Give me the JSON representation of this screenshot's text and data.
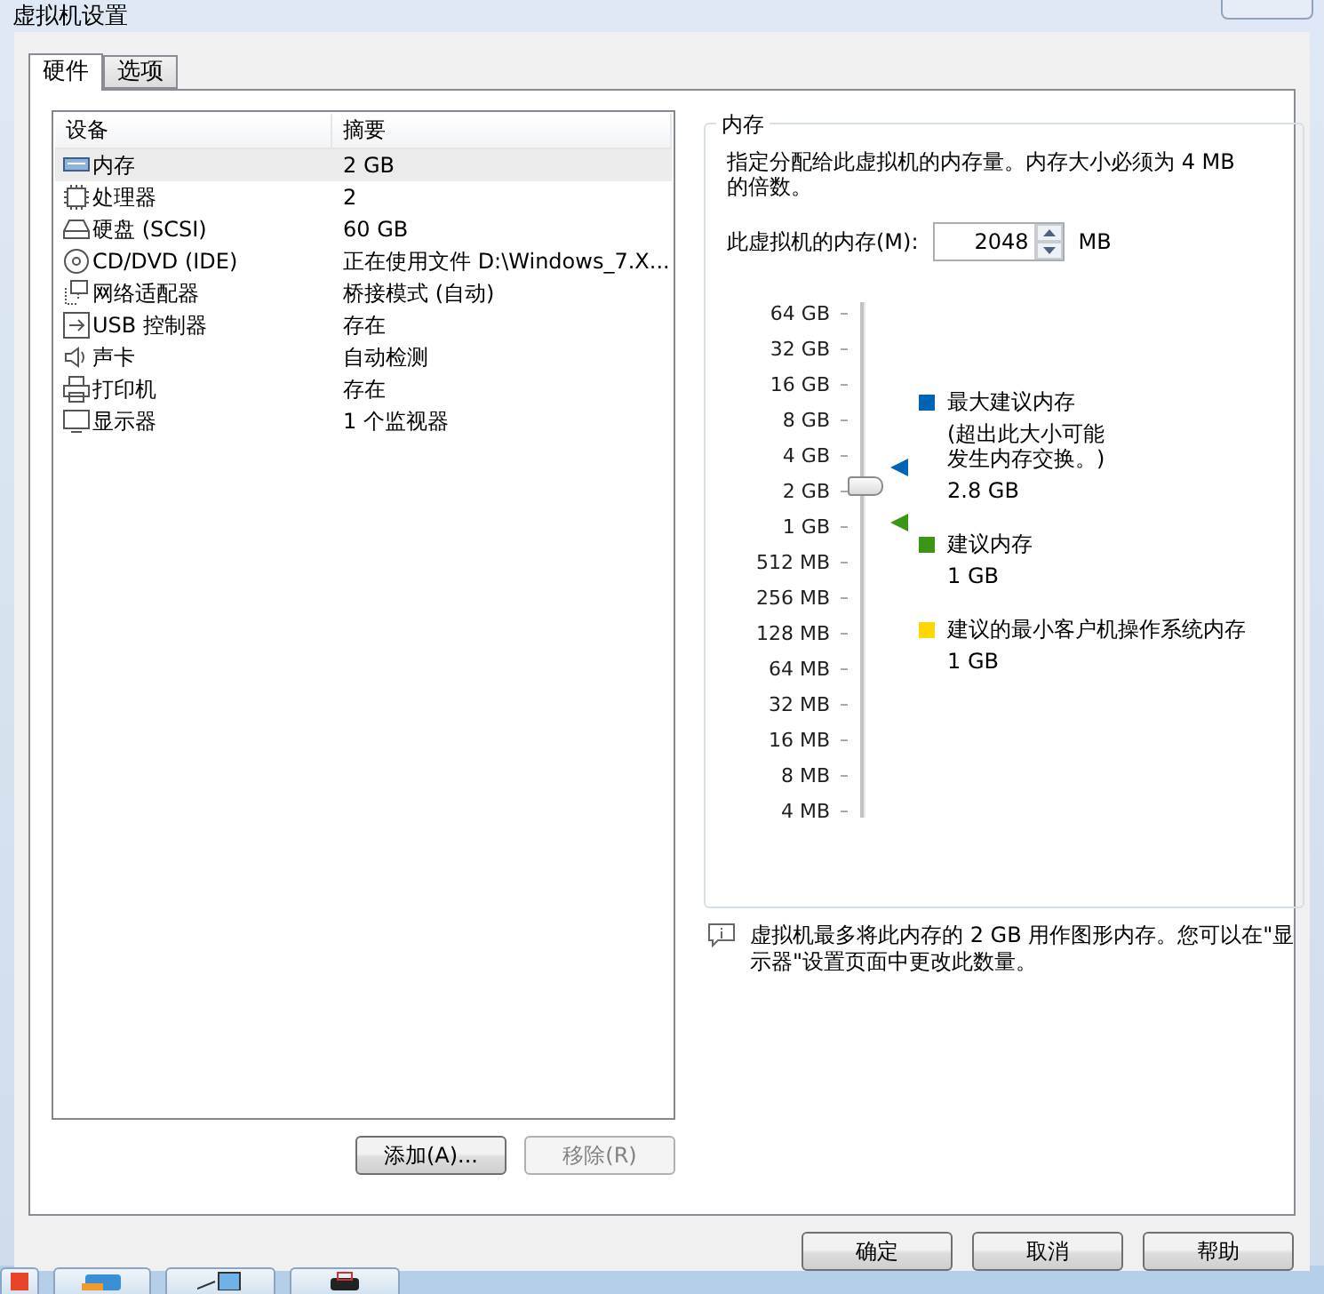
{
  "window": {
    "title": "虚拟机设置"
  },
  "tabs": [
    {
      "label": "硬件",
      "selected": true
    },
    {
      "label": "选项",
      "selected": false
    }
  ],
  "device_table": {
    "columns": [
      "设备",
      "摘要"
    ],
    "rows": [
      {
        "kind": "memory",
        "device": "内存",
        "summary": "2 GB",
        "selected": true
      },
      {
        "kind": "cpu",
        "device": "处理器",
        "summary": "2",
        "selected": false
      },
      {
        "kind": "disk",
        "device": "硬盘 (SCSI)",
        "summary": "60 GB",
        "selected": false
      },
      {
        "kind": "cd",
        "device": "CD/DVD (IDE)",
        "summary": "正在使用文件 D:\\Windows_7.X...",
        "selected": false
      },
      {
        "kind": "network",
        "device": "网络适配器",
        "summary": "桥接模式 (自动)",
        "selected": false
      },
      {
        "kind": "usb",
        "device": "USB 控制器",
        "summary": "存在",
        "selected": false
      },
      {
        "kind": "sound",
        "device": "声卡",
        "summary": "自动检测",
        "selected": false
      },
      {
        "kind": "printer",
        "device": "打印机",
        "summary": "存在",
        "selected": false
      },
      {
        "kind": "display",
        "device": "显示器",
        "summary": "1 个监视器",
        "selected": false
      }
    ]
  },
  "list_buttons": [
    {
      "label": "添加(A)...",
      "disabled": false
    },
    {
      "label": "移除(R)",
      "disabled": true
    }
  ],
  "memory_group": {
    "title": "内存",
    "description": "指定分配给此虚拟机的内存量。内存大小必须为 4 MB 的倍数。",
    "field_label": "此虚拟机的内存(M):",
    "value": "2048",
    "unit": "MB",
    "scale_labels": [
      "64 GB",
      "32 GB",
      "16 GB",
      "8 GB",
      "4 GB",
      "2 GB",
      "1 GB",
      "512 MB",
      "256 MB",
      "128 MB",
      "64 MB",
      "32 MB",
      "16 MB",
      "8 MB",
      "4 MB"
    ],
    "slider": {
      "level": 0.643
    },
    "legend": [
      {
        "title": "最大建议内存",
        "note": "(超出此大小可能发生内存交换。)",
        "value": "2.8 GB",
        "color": "#0064b4",
        "level": 0.68
      },
      {
        "title": "建议内存",
        "value": "1 GB",
        "color": "#3c9614",
        "level": 0.571
      },
      {
        "title": "建议的最小客户机操作系统内存",
        "value": "1 GB",
        "color": "#ffd700"
      }
    ]
  },
  "info": "虚拟机最多将此内存的 2 GB 用作图形内存。您可以在\"显示器\"设置页面中更改此数量。",
  "dialog_buttons": [
    "确定",
    "取消",
    "帮助"
  ]
}
